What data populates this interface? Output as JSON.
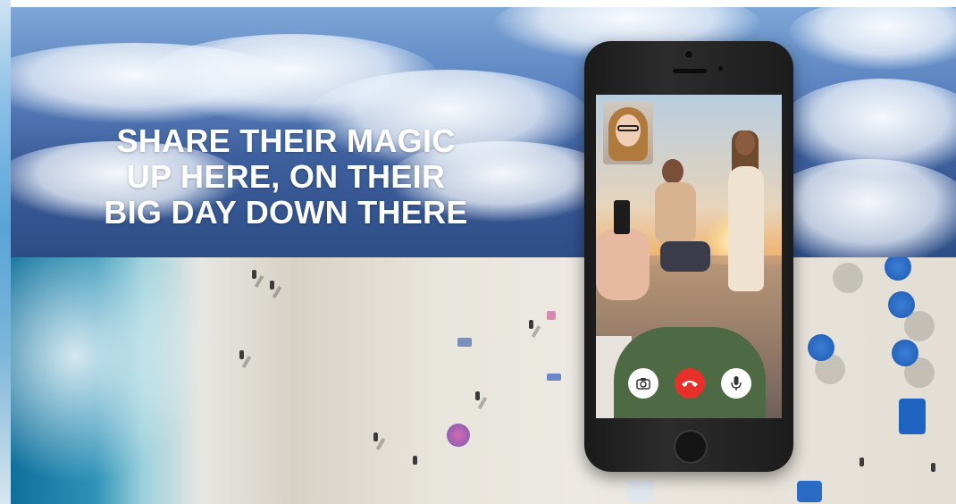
{
  "banner": {
    "headline_lines": [
      "SHARE THEIR MAGIC",
      "UP HERE, ON THEIR",
      "BIG DAY DOWN THERE"
    ]
  },
  "phone": {
    "call_controls": {
      "camera_icon": "camera-icon",
      "end_call_icon": "end-call-icon",
      "mic_icon": "microphone-icon"
    }
  },
  "colors": {
    "headline": "#ffffff",
    "end_call": "#e8302a",
    "umbrella": "#2a6bc6"
  }
}
